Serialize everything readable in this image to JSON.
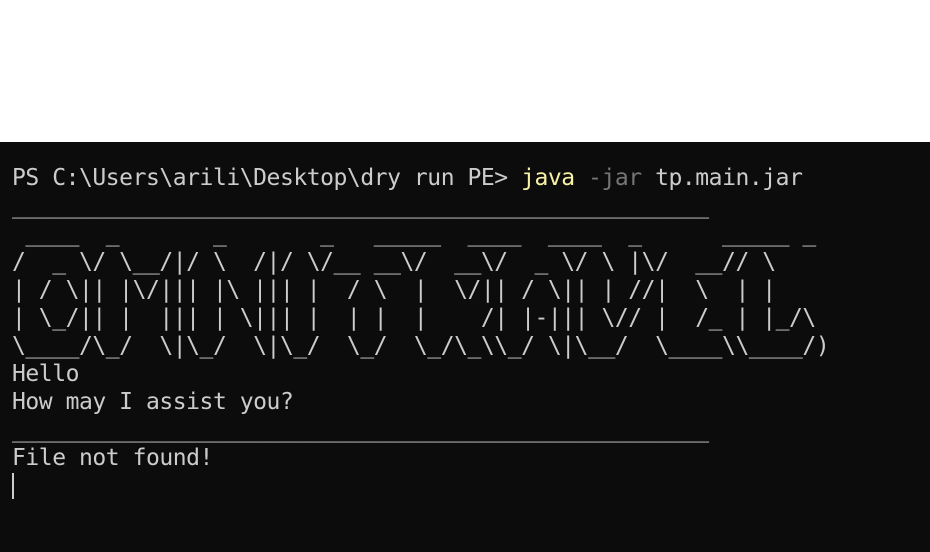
{
  "terminal": {
    "prompt": "PS C:\\Users\\arili\\Desktop\\dry run PE> ",
    "command": {
      "program": "java",
      "flag": "-jar",
      "arg": "tp.main.jar"
    },
    "separator_top": "____________________________________________________",
    "ascii_art": [
      " ____  _       _       _   _____  ____  ____  _      _____ _",
      "/  _ \\/ \\__/|/ \\  /|/ \\/__ __\\/  __\\/  _ \\/ \\ |\\/  __// \\",
      "| / \\|| |\\/||| |\\ ||| |  / \\  |  \\/|| / \\|| | //|  \\  | |",
      "| \\_/|| |  ||| | \\||| |  | |  |    /| |-||| \\// |  /_ | |_/\\",
      "\\____/\\_/  \\|\\_/  \\|\\_/  \\_/  \\_/\\_\\\\_/ \\|\\__/  \\____\\\\____/)"
    ],
    "greeting": "Hello",
    "question": "How may I assist you?",
    "separator_bottom": "____________________________________________________",
    "error": "File not found!"
  },
  "colors": {
    "background": "#0c0c0c",
    "text": "#cccccc",
    "command_name": "#f9f1a5",
    "command_flag": "#767676"
  }
}
